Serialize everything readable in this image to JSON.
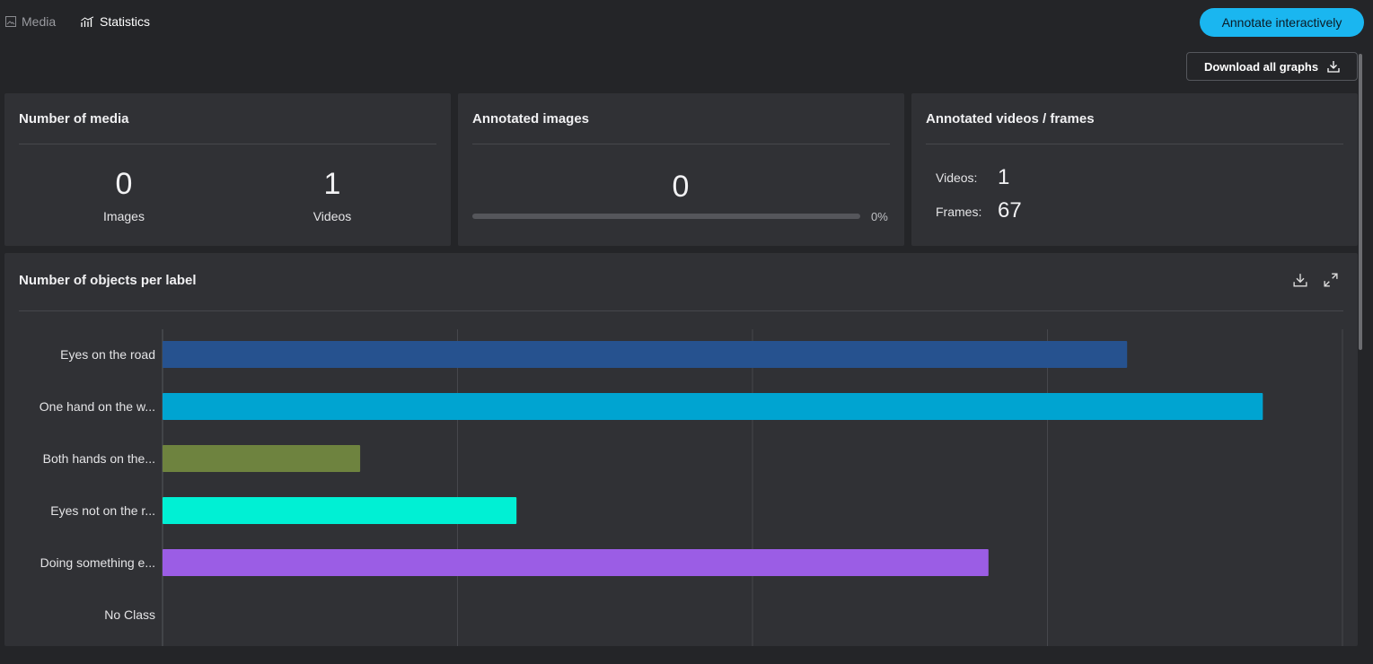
{
  "tabs": {
    "media": {
      "label": "Media",
      "icon": "image-icon"
    },
    "statistics": {
      "label": "Statistics",
      "icon": "bar-chart-icon"
    }
  },
  "actions": {
    "annotate_label": "Annotate interactively",
    "download_all_label": "Download all graphs",
    "accent": "#1ab6f0"
  },
  "cards": {
    "media": {
      "title": "Number of media",
      "images_value": "0",
      "images_label": "Images",
      "videos_value": "1",
      "videos_label": "Videos"
    },
    "annotated_images": {
      "title": "Annotated images",
      "value": "0",
      "progress_percent": 0,
      "percent_label": "0%"
    },
    "annotated_videos": {
      "title": "Annotated videos / frames",
      "videos_label": "Videos:",
      "videos_value": "1",
      "frames_label": "Frames:",
      "frames_value": "67"
    }
  },
  "chart_panel": {
    "title": "Number of objects per label"
  },
  "chart_data": {
    "type": "bar",
    "orientation": "horizontal",
    "title": "Number of objects per label",
    "categories": [
      "Eyes on the road",
      "One hand on the w...",
      "Both hands on the...",
      "Eyes not on the r...",
      "Doing something e...",
      "No Class"
    ],
    "values": [
      32.7,
      37.3,
      6.7,
      12.0,
      28.0,
      0
    ],
    "colors": [
      "#26528f",
      "#00a4d1",
      "#6e833f",
      "#00f0d4",
      "#9b5de5",
      "#888888"
    ],
    "xlim": [
      0,
      40
    ],
    "grid": true,
    "legend": "none"
  }
}
